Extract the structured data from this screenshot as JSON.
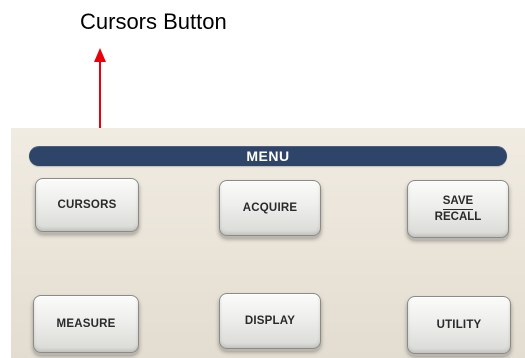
{
  "annotation": {
    "label": "Cursors Button",
    "arrow_color": "#e8000b"
  },
  "panel": {
    "menu_title": "MENU",
    "menu_bar_color": "#2f4469",
    "buttons": {
      "cursors": "CURSORS",
      "acquire": "ACQUIRE",
      "save_recall_top": "SAVE",
      "save_recall_bottom": "RECALL",
      "measure": "MEASURE",
      "display": "DISPLAY",
      "utility": "UTILITY"
    }
  }
}
